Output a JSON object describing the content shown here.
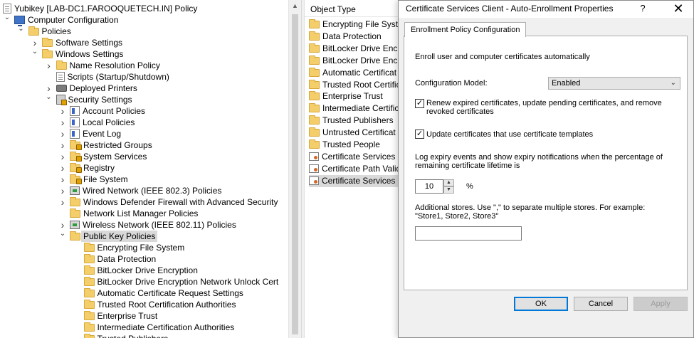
{
  "tree": {
    "items": [
      {
        "label": "Yubikey [LAB-DC1.FAROOQUETECH.IN] Policy",
        "icon": "policy-doc-icon",
        "expander": "",
        "indent": 0
      },
      {
        "label": "Computer Configuration",
        "icon": "computer-icon",
        "expander": "expanded",
        "indent": 0
      },
      {
        "label": "Policies",
        "icon": "folder-icon",
        "expander": "expanded",
        "indent": 1
      },
      {
        "label": "Software Settings",
        "icon": "folder-icon",
        "expander": "collapsed",
        "indent": 2
      },
      {
        "label": "Windows Settings",
        "icon": "folder-icon",
        "expander": "expanded",
        "indent": 2
      },
      {
        "label": "Name Resolution Policy",
        "icon": "folder-icon",
        "expander": "collapsed",
        "indent": 3
      },
      {
        "label": "Scripts (Startup/Shutdown)",
        "icon": "script-icon",
        "expander": "",
        "indent": 3
      },
      {
        "label": "Deployed Printers",
        "icon": "printer-icon",
        "expander": "collapsed",
        "indent": 3
      },
      {
        "label": "Security Settings",
        "icon": "security-icon",
        "expander": "expanded",
        "indent": 3
      },
      {
        "label": "Account Policies",
        "icon": "policy-icon",
        "expander": "collapsed",
        "indent": 4
      },
      {
        "label": "Local Policies",
        "icon": "policy-icon",
        "expander": "collapsed",
        "indent": 4
      },
      {
        "label": "Event Log",
        "icon": "policy-icon",
        "expander": "collapsed",
        "indent": 4
      },
      {
        "label": "Restricted Groups",
        "icon": "locked-folder-icon",
        "expander": "collapsed",
        "indent": 4
      },
      {
        "label": "System Services",
        "icon": "locked-folder-icon",
        "expander": "collapsed",
        "indent": 4
      },
      {
        "label": "Registry",
        "icon": "locked-folder-icon",
        "expander": "collapsed",
        "indent": 4
      },
      {
        "label": "File System",
        "icon": "locked-folder-icon",
        "expander": "collapsed",
        "indent": 4
      },
      {
        "label": "Wired Network (IEEE 802.3) Policies",
        "icon": "network-icon",
        "expander": "collapsed",
        "indent": 4
      },
      {
        "label": "Windows Defender Firewall with Advanced Security",
        "icon": "folder-icon",
        "expander": "collapsed",
        "indent": 4
      },
      {
        "label": "Network List Manager Policies",
        "icon": "folder-icon",
        "expander": "",
        "indent": 4
      },
      {
        "label": "Wireless Network (IEEE 802.11) Policies",
        "icon": "network-icon",
        "expander": "collapsed",
        "indent": 4
      },
      {
        "label": "Public Key Policies",
        "icon": "folder-icon",
        "expander": "expanded",
        "indent": 4,
        "selected": true
      },
      {
        "label": "Encrypting File System",
        "icon": "folder-icon",
        "expander": "",
        "indent": 5
      },
      {
        "label": "Data Protection",
        "icon": "folder-icon",
        "expander": "",
        "indent": 5
      },
      {
        "label": "BitLocker Drive Encryption",
        "icon": "folder-icon",
        "expander": "",
        "indent": 5
      },
      {
        "label": "BitLocker Drive Encryption Network Unlock Cert",
        "icon": "folder-icon",
        "expander": "",
        "indent": 5
      },
      {
        "label": "Automatic Certificate Request Settings",
        "icon": "folder-icon",
        "expander": "",
        "indent": 5
      },
      {
        "label": "Trusted Root Certification Authorities",
        "icon": "folder-icon",
        "expander": "",
        "indent": 5
      },
      {
        "label": "Enterprise Trust",
        "icon": "folder-icon",
        "expander": "",
        "indent": 5
      },
      {
        "label": "Intermediate Certification Authorities",
        "icon": "folder-icon",
        "expander": "",
        "indent": 5
      },
      {
        "label": "Trusted Publishers",
        "icon": "folder-icon",
        "expander": "",
        "indent": 5
      }
    ]
  },
  "list": {
    "header": "Object Type",
    "items": [
      {
        "label": "Encrypting File Syste",
        "icon": "folder-icon"
      },
      {
        "label": "Data Protection",
        "icon": "folder-icon"
      },
      {
        "label": "BitLocker Drive Encr",
        "icon": "folder-icon"
      },
      {
        "label": "BitLocker Drive Encr",
        "icon": "folder-icon"
      },
      {
        "label": "Automatic Certificat",
        "icon": "folder-icon"
      },
      {
        "label": "Trusted Root Certific",
        "icon": "folder-icon"
      },
      {
        "label": "Enterprise Trust",
        "icon": "folder-icon"
      },
      {
        "label": "Intermediate Certific",
        "icon": "folder-icon"
      },
      {
        "label": "Trusted Publishers",
        "icon": "folder-icon"
      },
      {
        "label": "Untrusted Certificat",
        "icon": "folder-icon"
      },
      {
        "label": "Trusted People",
        "icon": "folder-icon"
      },
      {
        "label": "Certificate Services C",
        "icon": "certificate-icon"
      },
      {
        "label": "Certificate Path Valid",
        "icon": "certificate-icon"
      },
      {
        "label": "Certificate Services C",
        "icon": "certificate-icon",
        "selected": true
      }
    ]
  },
  "dialog": {
    "title": "Certificate Services Client - Auto-Enrollment Properties",
    "help_glyph": "?",
    "close_glyph": "✕",
    "tab_label": "Enrollment Policy Configuration",
    "enroll_text": "Enroll user and computer certificates automatically",
    "config_model_label": "Configuration Model:",
    "config_model_value": "Enabled",
    "renew_checked": true,
    "renew_label_line1": "Renew expired certificates, update pending certificates, and remove",
    "renew_label_line2": "revoked certificates",
    "update_checked": true,
    "update_label": "Update certificates that use certificate templates",
    "expiry_line1": "Log expiry events and show expiry notifications when the percentage of",
    "expiry_line2": "remaining certificate lifetime is",
    "expiry_value": "10",
    "percent_label": "%",
    "stores_line1": "Additional stores. Use \",\" to separate multiple stores. For example:",
    "stores_line2": "\"Store1, Store2, Store3\"",
    "stores_value": "",
    "ok_label": "OK",
    "cancel_label": "Cancel",
    "apply_label": "Apply",
    "check_glyph": "✓"
  }
}
